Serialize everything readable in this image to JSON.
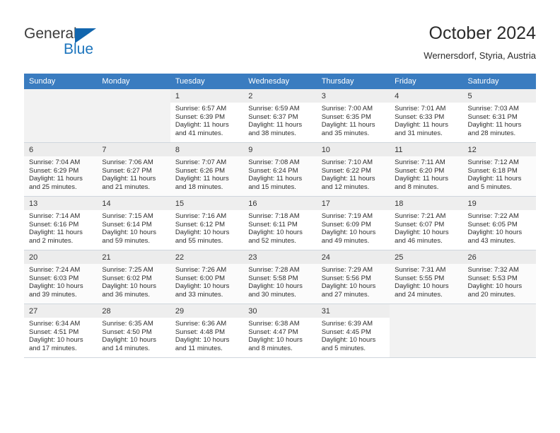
{
  "brand": {
    "name_part1": "General",
    "name_part2": "Blue",
    "accent_color": "#1b74bd",
    "triangle_color": "#1266ae"
  },
  "header": {
    "title": "October 2024",
    "subtitle": "Wernersdorf, Styria, Austria"
  },
  "calendar": {
    "header_bg": "#3a7cc0",
    "weekday_headers": [
      "Sunday",
      "Monday",
      "Tuesday",
      "Wednesday",
      "Thursday",
      "Friday",
      "Saturday"
    ],
    "labels": {
      "sunrise": "Sunrise:",
      "sunset": "Sunset:",
      "daylight": "Daylight:"
    },
    "weeks": [
      [
        {
          "day": "",
          "sunrise": "",
          "sunset": "",
          "daylight_line1": "",
          "daylight_line2": ""
        },
        {
          "day": "",
          "sunrise": "",
          "sunset": "",
          "daylight_line1": "",
          "daylight_line2": ""
        },
        {
          "day": "1",
          "sunrise": "Sunrise: 6:57 AM",
          "sunset": "Sunset: 6:39 PM",
          "daylight_line1": "Daylight: 11 hours",
          "daylight_line2": "and 41 minutes."
        },
        {
          "day": "2",
          "sunrise": "Sunrise: 6:59 AM",
          "sunset": "Sunset: 6:37 PM",
          "daylight_line1": "Daylight: 11 hours",
          "daylight_line2": "and 38 minutes."
        },
        {
          "day": "3",
          "sunrise": "Sunrise: 7:00 AM",
          "sunset": "Sunset: 6:35 PM",
          "daylight_line1": "Daylight: 11 hours",
          "daylight_line2": "and 35 minutes."
        },
        {
          "day": "4",
          "sunrise": "Sunrise: 7:01 AM",
          "sunset": "Sunset: 6:33 PM",
          "daylight_line1": "Daylight: 11 hours",
          "daylight_line2": "and 31 minutes."
        },
        {
          "day": "5",
          "sunrise": "Sunrise: 7:03 AM",
          "sunset": "Sunset: 6:31 PM",
          "daylight_line1": "Daylight: 11 hours",
          "daylight_line2": "and 28 minutes."
        }
      ],
      [
        {
          "day": "6",
          "sunrise": "Sunrise: 7:04 AM",
          "sunset": "Sunset: 6:29 PM",
          "daylight_line1": "Daylight: 11 hours",
          "daylight_line2": "and 25 minutes."
        },
        {
          "day": "7",
          "sunrise": "Sunrise: 7:06 AM",
          "sunset": "Sunset: 6:27 PM",
          "daylight_line1": "Daylight: 11 hours",
          "daylight_line2": "and 21 minutes."
        },
        {
          "day": "8",
          "sunrise": "Sunrise: 7:07 AM",
          "sunset": "Sunset: 6:26 PM",
          "daylight_line1": "Daylight: 11 hours",
          "daylight_line2": "and 18 minutes."
        },
        {
          "day": "9",
          "sunrise": "Sunrise: 7:08 AM",
          "sunset": "Sunset: 6:24 PM",
          "daylight_line1": "Daylight: 11 hours",
          "daylight_line2": "and 15 minutes."
        },
        {
          "day": "10",
          "sunrise": "Sunrise: 7:10 AM",
          "sunset": "Sunset: 6:22 PM",
          "daylight_line1": "Daylight: 11 hours",
          "daylight_line2": "and 12 minutes."
        },
        {
          "day": "11",
          "sunrise": "Sunrise: 7:11 AM",
          "sunset": "Sunset: 6:20 PM",
          "daylight_line1": "Daylight: 11 hours",
          "daylight_line2": "and 8 minutes."
        },
        {
          "day": "12",
          "sunrise": "Sunrise: 7:12 AM",
          "sunset": "Sunset: 6:18 PM",
          "daylight_line1": "Daylight: 11 hours",
          "daylight_line2": "and 5 minutes."
        }
      ],
      [
        {
          "day": "13",
          "sunrise": "Sunrise: 7:14 AM",
          "sunset": "Sunset: 6:16 PM",
          "daylight_line1": "Daylight: 11 hours",
          "daylight_line2": "and 2 minutes."
        },
        {
          "day": "14",
          "sunrise": "Sunrise: 7:15 AM",
          "sunset": "Sunset: 6:14 PM",
          "daylight_line1": "Daylight: 10 hours",
          "daylight_line2": "and 59 minutes."
        },
        {
          "day": "15",
          "sunrise": "Sunrise: 7:16 AM",
          "sunset": "Sunset: 6:12 PM",
          "daylight_line1": "Daylight: 10 hours",
          "daylight_line2": "and 55 minutes."
        },
        {
          "day": "16",
          "sunrise": "Sunrise: 7:18 AM",
          "sunset": "Sunset: 6:11 PM",
          "daylight_line1": "Daylight: 10 hours",
          "daylight_line2": "and 52 minutes."
        },
        {
          "day": "17",
          "sunrise": "Sunrise: 7:19 AM",
          "sunset": "Sunset: 6:09 PM",
          "daylight_line1": "Daylight: 10 hours",
          "daylight_line2": "and 49 minutes."
        },
        {
          "day": "18",
          "sunrise": "Sunrise: 7:21 AM",
          "sunset": "Sunset: 6:07 PM",
          "daylight_line1": "Daylight: 10 hours",
          "daylight_line2": "and 46 minutes."
        },
        {
          "day": "19",
          "sunrise": "Sunrise: 7:22 AM",
          "sunset": "Sunset: 6:05 PM",
          "daylight_line1": "Daylight: 10 hours",
          "daylight_line2": "and 43 minutes."
        }
      ],
      [
        {
          "day": "20",
          "sunrise": "Sunrise: 7:24 AM",
          "sunset": "Sunset: 6:03 PM",
          "daylight_line1": "Daylight: 10 hours",
          "daylight_line2": "and 39 minutes."
        },
        {
          "day": "21",
          "sunrise": "Sunrise: 7:25 AM",
          "sunset": "Sunset: 6:02 PM",
          "daylight_line1": "Daylight: 10 hours",
          "daylight_line2": "and 36 minutes."
        },
        {
          "day": "22",
          "sunrise": "Sunrise: 7:26 AM",
          "sunset": "Sunset: 6:00 PM",
          "daylight_line1": "Daylight: 10 hours",
          "daylight_line2": "and 33 minutes."
        },
        {
          "day": "23",
          "sunrise": "Sunrise: 7:28 AM",
          "sunset": "Sunset: 5:58 PM",
          "daylight_line1": "Daylight: 10 hours",
          "daylight_line2": "and 30 minutes."
        },
        {
          "day": "24",
          "sunrise": "Sunrise: 7:29 AM",
          "sunset": "Sunset: 5:56 PM",
          "daylight_line1": "Daylight: 10 hours",
          "daylight_line2": "and 27 minutes."
        },
        {
          "day": "25",
          "sunrise": "Sunrise: 7:31 AM",
          "sunset": "Sunset: 5:55 PM",
          "daylight_line1": "Daylight: 10 hours",
          "daylight_line2": "and 24 minutes."
        },
        {
          "day": "26",
          "sunrise": "Sunrise: 7:32 AM",
          "sunset": "Sunset: 5:53 PM",
          "daylight_line1": "Daylight: 10 hours",
          "daylight_line2": "and 20 minutes."
        }
      ],
      [
        {
          "day": "27",
          "sunrise": "Sunrise: 6:34 AM",
          "sunset": "Sunset: 4:51 PM",
          "daylight_line1": "Daylight: 10 hours",
          "daylight_line2": "and 17 minutes."
        },
        {
          "day": "28",
          "sunrise": "Sunrise: 6:35 AM",
          "sunset": "Sunset: 4:50 PM",
          "daylight_line1": "Daylight: 10 hours",
          "daylight_line2": "and 14 minutes."
        },
        {
          "day": "29",
          "sunrise": "Sunrise: 6:36 AM",
          "sunset": "Sunset: 4:48 PM",
          "daylight_line1": "Daylight: 10 hours",
          "daylight_line2": "and 11 minutes."
        },
        {
          "day": "30",
          "sunrise": "Sunrise: 6:38 AM",
          "sunset": "Sunset: 4:47 PM",
          "daylight_line1": "Daylight: 10 hours",
          "daylight_line2": "and 8 minutes."
        },
        {
          "day": "31",
          "sunrise": "Sunrise: 6:39 AM",
          "sunset": "Sunset: 4:45 PM",
          "daylight_line1": "Daylight: 10 hours",
          "daylight_line2": "and 5 minutes."
        },
        {
          "day": "",
          "sunrise": "",
          "sunset": "",
          "daylight_line1": "",
          "daylight_line2": ""
        },
        {
          "day": "",
          "sunrise": "",
          "sunset": "",
          "daylight_line1": "",
          "daylight_line2": ""
        }
      ]
    ]
  }
}
